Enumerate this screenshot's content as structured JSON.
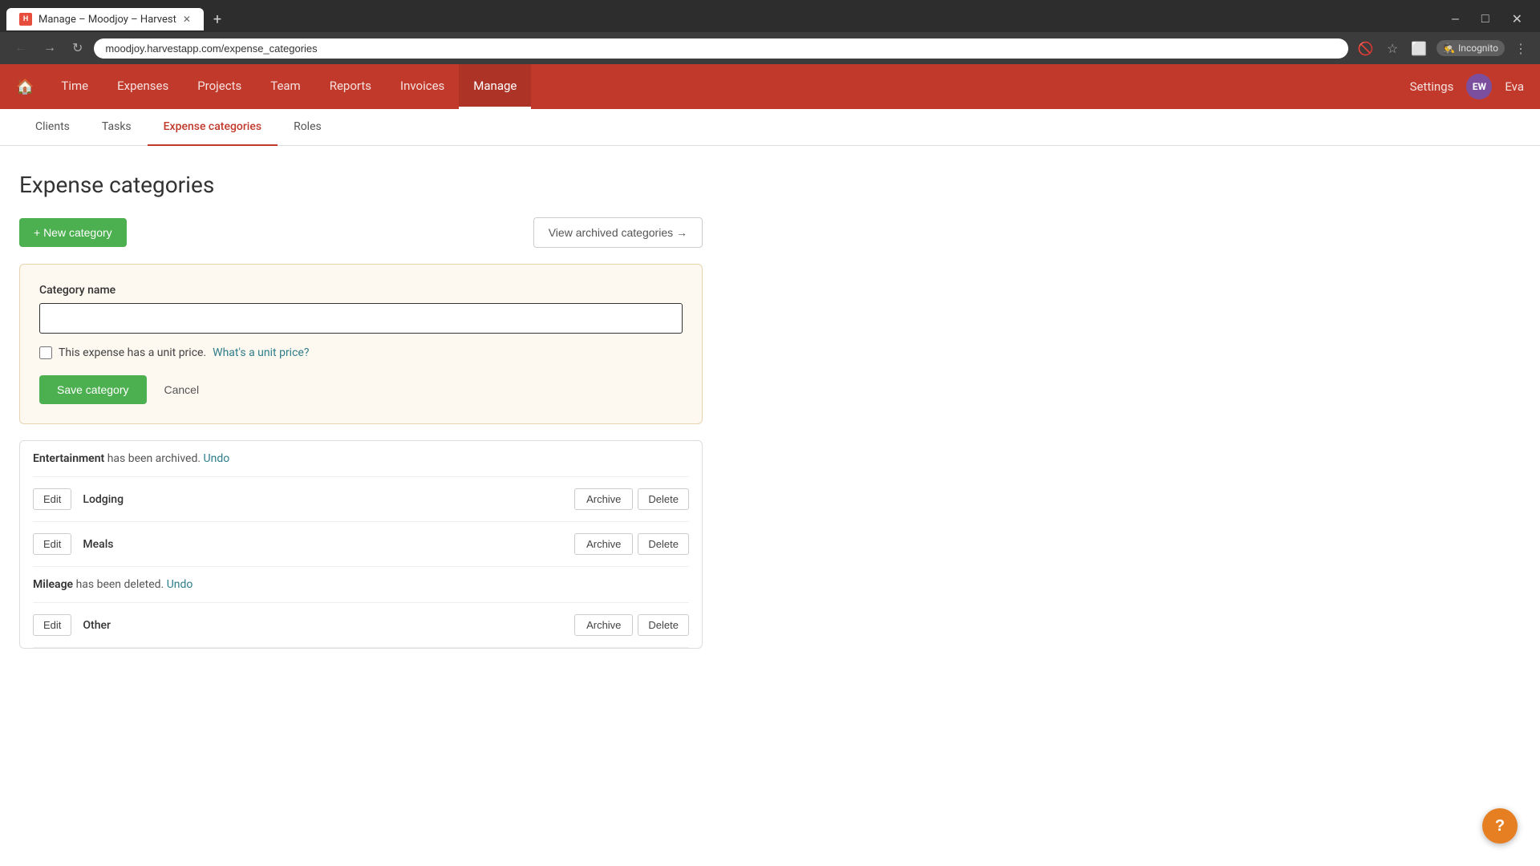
{
  "browser": {
    "tab_title": "Manage – Moodjoy – Harvest",
    "tab_favicon": "H",
    "url": "moodjoy.harvestapp.com/expense_categories",
    "incognito_label": "Incognito"
  },
  "nav": {
    "links": [
      {
        "label": "Time",
        "active": false
      },
      {
        "label": "Expenses",
        "active": false
      },
      {
        "label": "Projects",
        "active": false
      },
      {
        "label": "Team",
        "active": false
      },
      {
        "label": "Reports",
        "active": false
      },
      {
        "label": "Invoices",
        "active": false
      },
      {
        "label": "Manage",
        "active": true
      }
    ],
    "settings_label": "Settings",
    "user_initials": "EW",
    "user_name": "Eva"
  },
  "sub_nav": {
    "items": [
      {
        "label": "Clients",
        "active": false
      },
      {
        "label": "Tasks",
        "active": false
      },
      {
        "label": "Expense categories",
        "active": true
      },
      {
        "label": "Roles",
        "active": false
      }
    ]
  },
  "page": {
    "title": "Expense categories",
    "new_category_btn": "+ New category",
    "view_archived_btn": "View archived categories →"
  },
  "new_category_form": {
    "label": "Category name",
    "input_placeholder": "",
    "checkbox_label": "This expense has a unit price.",
    "unit_price_link": "What's a unit price?",
    "save_btn": "Save category",
    "cancel_btn": "Cancel"
  },
  "notifications": [
    {
      "name": "Entertainment",
      "message": " has been archived. ",
      "undo_label": "Undo"
    },
    {
      "name": "Mileage",
      "message": " has been deleted. ",
      "undo_label": "Undo"
    }
  ],
  "categories": [
    {
      "name": "Lodging",
      "edit_label": "Edit",
      "archive_label": "Archive",
      "delete_label": "Delete"
    },
    {
      "name": "Meals",
      "edit_label": "Edit",
      "archive_label": "Archive",
      "delete_label": "Delete"
    },
    {
      "name": "Other",
      "edit_label": "Edit",
      "archive_label": "Archive",
      "delete_label": "Delete"
    }
  ],
  "help_btn": "?"
}
